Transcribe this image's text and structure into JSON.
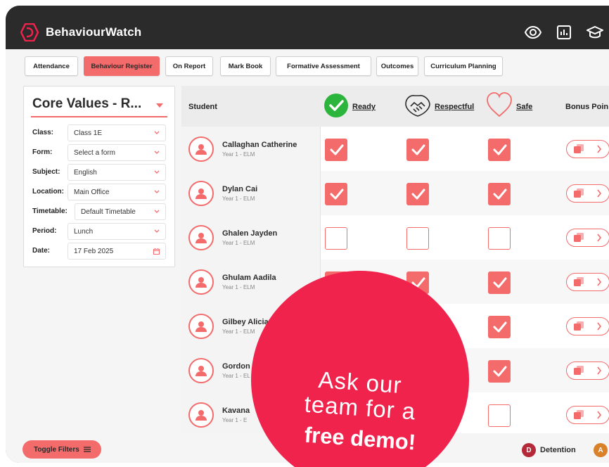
{
  "app": {
    "title": "BehaviourWatch"
  },
  "topbar_icons": [
    "eye-icon",
    "chart-icon",
    "graduation-cap-icon"
  ],
  "tabs": [
    {
      "label": "Attendance",
      "active": false
    },
    {
      "label": "Behaviour Register",
      "active": true
    },
    {
      "label": "On Report",
      "active": false
    },
    {
      "label": "Mark Book",
      "active": false
    },
    {
      "label": "Formative Assessment",
      "active": false
    },
    {
      "label": "Outcomes",
      "active": false
    },
    {
      "label": "Curriculum Planning",
      "active": false
    }
  ],
  "filters": {
    "title": "Core Values - R...",
    "rows": [
      {
        "label": "Class:",
        "value": "Class 1E"
      },
      {
        "label": "Form:",
        "value": "Select a form"
      },
      {
        "label": "Subject:",
        "value": "English"
      },
      {
        "label": "Location:",
        "value": "Main Office"
      },
      {
        "label": "Timetable:",
        "value": "Default Timetable"
      },
      {
        "label": "Period:",
        "value": "Lunch"
      },
      {
        "label": "Date:",
        "value": "17 Feb 2025"
      }
    ]
  },
  "table": {
    "student_header": "Student",
    "columns": [
      {
        "label": "Ready",
        "icon": "check-circle-icon"
      },
      {
        "label": "Respectful",
        "icon": "handshake-icon"
      },
      {
        "label": "Safe",
        "icon": "heart-icon"
      }
    ],
    "bonus_header": "Bonus Poin",
    "rows": [
      {
        "name": "Callaghan Catherine",
        "class": "Year 1 - ELM",
        "ready": true,
        "respectful": true,
        "safe": true
      },
      {
        "name": "Dylan Cai",
        "class": "Year 1 - ELM",
        "ready": true,
        "respectful": true,
        "safe": true
      },
      {
        "name": "Ghalen Jayden",
        "class": "Year 1 - ELM",
        "ready": false,
        "respectful": false,
        "safe": false
      },
      {
        "name": "Ghulam Aadila",
        "class": "Year 1 - ELM",
        "ready": true,
        "respectful": true,
        "safe": true
      },
      {
        "name": "Gilbey Alicia",
        "class": "Year 1 - ELM",
        "ready": true,
        "respectful": true,
        "safe": true
      },
      {
        "name": "Gordon K",
        "class": "Year 1 - EL",
        "ready": true,
        "respectful": true,
        "safe": true
      },
      {
        "name": "Kavana",
        "class": "Year 1 - E",
        "ready": false,
        "respectful": false,
        "safe": false
      }
    ]
  },
  "bottom": {
    "toggle_filters": "Toggle Filters",
    "legend": [
      {
        "letter": "D",
        "label": "Detention",
        "color": "#b5283a"
      },
      {
        "letter": "A",
        "label": "",
        "color": "#d9822b"
      }
    ]
  },
  "promo": {
    "line1": "Ask our",
    "line2": "team for a",
    "line3": "free demo!"
  },
  "colors": {
    "accent": "#f36b6b",
    "promo": "#f0234d",
    "ready_green": "#2bb53c",
    "dark": "#2b2b2b"
  }
}
